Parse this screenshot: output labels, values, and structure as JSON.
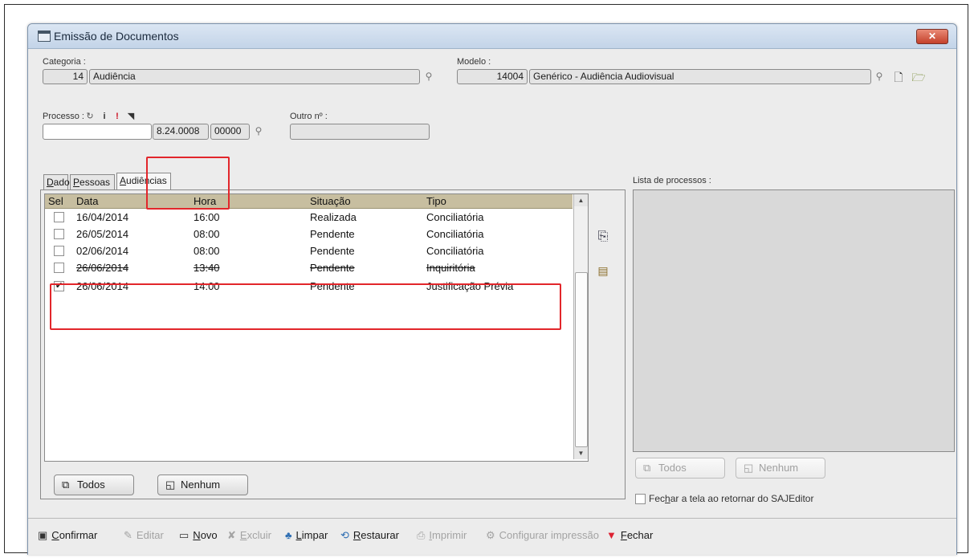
{
  "window": {
    "title": "Emissão de Documentos",
    "close_label": "✕"
  },
  "categoria": {
    "label": "Categoria :",
    "code": "14",
    "name": "Audiência"
  },
  "modelo": {
    "label": "Modelo :",
    "code": "14004",
    "name": "Genérico - Audiência Audiovisual"
  },
  "processo": {
    "label": "Processo :",
    "part1": "",
    "part2": "8.24.0008",
    "part3": "00000"
  },
  "outro": {
    "label": "Outro nº :",
    "value": ""
  },
  "tabs": [
    {
      "label": "Dados",
      "accel": "D",
      "rest": "ados"
    },
    {
      "label": "Pessoas",
      "accel": "P",
      "rest": "essoas"
    },
    {
      "label": "Audiências",
      "accel": "A",
      "rest": "udiências"
    }
  ],
  "grid": {
    "columns": [
      "Sel",
      "Data",
      "Hora",
      "Situação",
      "Tipo"
    ],
    "rows": [
      {
        "checked": false,
        "data": "16/04/2014",
        "hora": "16:00",
        "situacao": "Realizada",
        "tipo": "Conciliatória"
      },
      {
        "checked": false,
        "data": "26/05/2014",
        "hora": "08:00",
        "situacao": "Pendente",
        "tipo": "Conciliatória"
      },
      {
        "checked": false,
        "data": "02/06/2014",
        "hora": "08:00",
        "situacao": "Pendente",
        "tipo": "Conciliatória"
      },
      {
        "checked": false,
        "data": "26/06/2014",
        "hora": "13:40",
        "situacao": "Pendente",
        "tipo": "Inquiritória"
      },
      {
        "checked": true,
        "data": "26/06/2014",
        "hora": "14:00",
        "situacao": "Pendente",
        "tipo": "Justificação Prévia"
      }
    ],
    "check_mark": "✔"
  },
  "buttons": {
    "todos": "Todos",
    "nenhum": "Nenhum"
  },
  "lista": {
    "label": "Lista de processos :",
    "todos": "Todos",
    "nenhum": "Nenhum",
    "fechar_pre": "Fec",
    "fechar_accel": "h",
    "fechar_post": "ar a tela ao retornar do SAJEditor"
  },
  "toolbar": [
    {
      "name": "confirmar",
      "accel": "C",
      "rest": "onfirmar",
      "icon": "save-icon",
      "glyph": "🖫",
      "color": "#333",
      "disabled": false
    },
    {
      "name": "editar",
      "accel": "",
      "rest": "Editar",
      "icon": "edit-icon",
      "glyph": "✎",
      "color": "#999",
      "disabled": true
    },
    {
      "name": "novo",
      "accel": "N",
      "rest": "ovo",
      "icon": "new-icon",
      "glyph": "▭",
      "color": "#333",
      "disabled": false
    },
    {
      "name": "excluir",
      "accel": "E",
      "rest": "xcluir",
      "icon": "delete-icon",
      "glyph": "✘",
      "color": "#999",
      "disabled": true
    },
    {
      "name": "limpar",
      "accel": "L",
      "rest": "impar",
      "icon": "broom-icon",
      "glyph": "♨",
      "color": "#2f6fb3",
      "disabled": false
    },
    {
      "name": "restaurar",
      "accel": "R",
      "rest": "estaurar",
      "icon": "restore-icon",
      "glyph": "⟲",
      "color": "#2f6fb3",
      "disabled": false
    },
    {
      "name": "imprimir",
      "accel": "I",
      "rest": "mprimir",
      "icon": "printer-icon",
      "glyph": "⎙",
      "color": "#999",
      "disabled": true
    },
    {
      "name": "configurar-impressao",
      "accel": "",
      "rest": "Configurar impressão",
      "icon": "print-settings-icon",
      "glyph": "⚙",
      "color": "#999",
      "disabled": true
    },
    {
      "name": "fechar",
      "accel": "F",
      "rest": "echar",
      "icon": "close-pin-icon",
      "glyph": "📍",
      "color": "#d23",
      "disabled": false
    }
  ]
}
